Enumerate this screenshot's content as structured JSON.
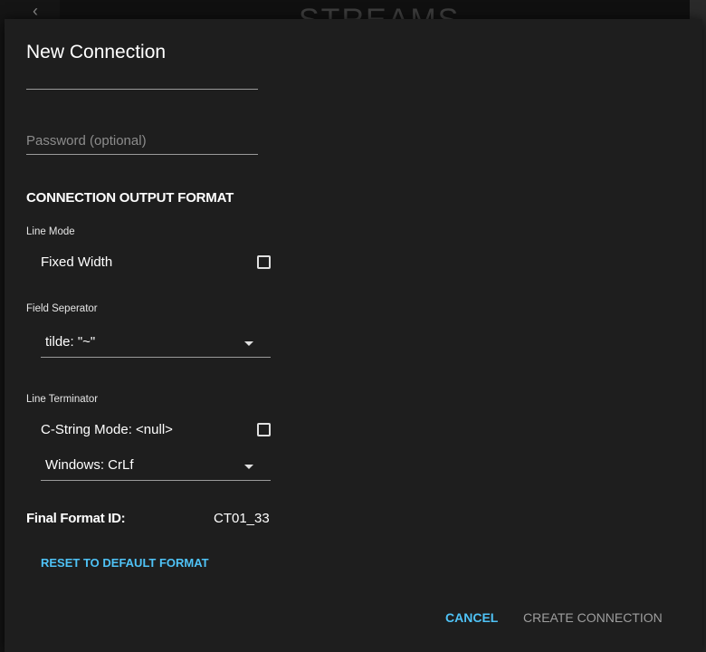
{
  "background": {
    "back_glyph": "‹",
    "title": "STREAMS"
  },
  "dialog": {
    "title": "New Connection",
    "password_placeholder": "Password (optional)",
    "section_title": "CONNECTION OUTPUT FORMAT",
    "line_mode": {
      "label": "Line Mode",
      "fixed_width_label": "Fixed Width",
      "fixed_width_checked": false
    },
    "field_separator": {
      "label": "Field Seperator",
      "selected": "tilde: \"~\""
    },
    "line_terminator": {
      "label": "Line Terminator",
      "cstring_label": "C-String Mode: <null>",
      "cstring_checked": false,
      "selected": "Windows: CrLf"
    },
    "final_format_label": "Final Format ID:",
    "final_format_value": "CT01_33",
    "reset_label": "RESET TO DEFAULT FORMAT",
    "cancel_label": "CANCEL",
    "create_label": "CREATE CONNECTION"
  },
  "colors": {
    "accent": "#4fc3f7",
    "dialog_bg": "#1e1e1e",
    "disabled_text": "#9e9e9e"
  }
}
